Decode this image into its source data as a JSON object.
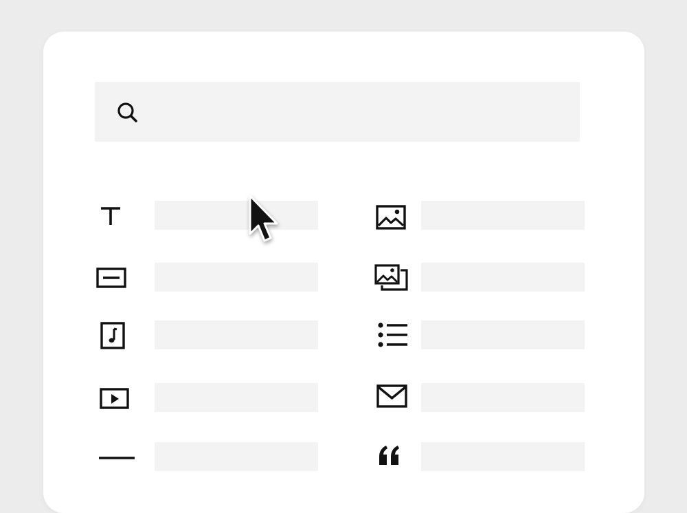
{
  "search": {
    "value": "",
    "placeholder": "",
    "icon": "search-icon"
  },
  "blocks": {
    "left": [
      {
        "icon": "text-icon",
        "label": ""
      },
      {
        "icon": "button-icon",
        "label": ""
      },
      {
        "icon": "audio-icon",
        "label": ""
      },
      {
        "icon": "video-icon",
        "label": ""
      },
      {
        "icon": "divider-icon",
        "label": ""
      }
    ],
    "right": [
      {
        "icon": "image-icon",
        "label": ""
      },
      {
        "icon": "gallery-icon",
        "label": ""
      },
      {
        "icon": "list-icon",
        "label": ""
      },
      {
        "icon": "email-icon",
        "label": ""
      },
      {
        "icon": "quote-icon",
        "label": ""
      }
    ]
  },
  "colors": {
    "background": "#ececec",
    "panel": "#ffffff",
    "placeholder_bar": "#f3f3f3",
    "icon": "#111111"
  }
}
